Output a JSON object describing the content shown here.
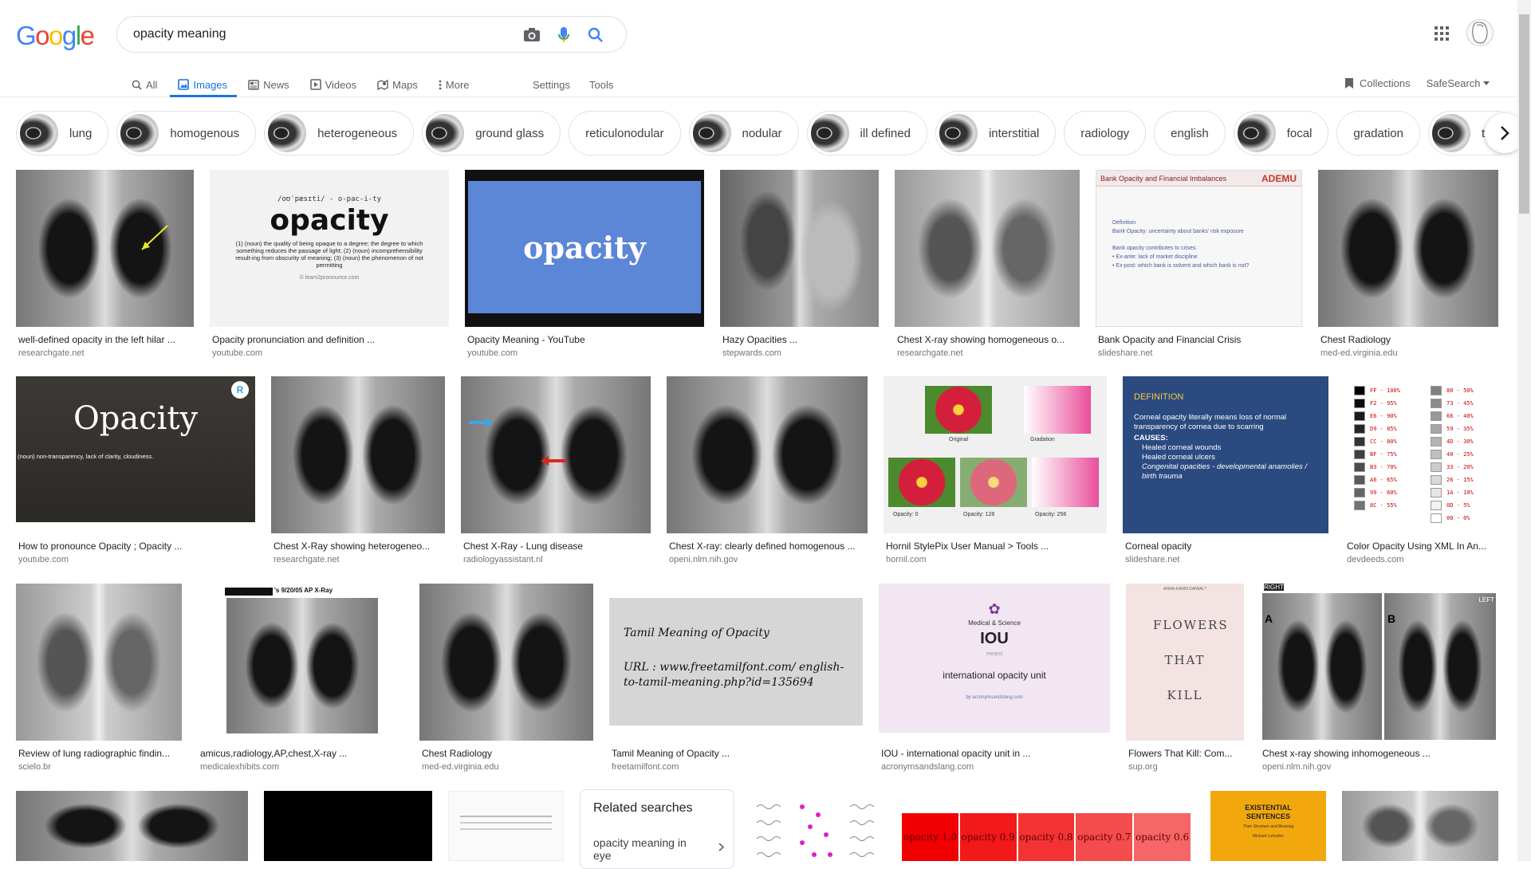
{
  "logo": [
    "G",
    "o",
    "o",
    "g",
    "l",
    "e"
  ],
  "search": {
    "value": "opacity meaning"
  },
  "tabs": [
    {
      "label": "All",
      "icon": "search-icon"
    },
    {
      "label": "Images",
      "icon": "image-icon",
      "active": true
    },
    {
      "label": "News",
      "icon": "news-icon"
    },
    {
      "label": "Videos",
      "icon": "play-icon"
    },
    {
      "label": "Maps",
      "icon": "map-pin-icon"
    },
    {
      "label": "More",
      "icon": "more-vertical-icon"
    }
  ],
  "tools": {
    "settings": "Settings",
    "tools": "Tools"
  },
  "right": {
    "collections": "Collections",
    "safesearch": "SafeSearch"
  },
  "chips": [
    {
      "label": "lung",
      "img": true
    },
    {
      "label": "homogenous",
      "img": true
    },
    {
      "label": "heterogeneous",
      "img": true
    },
    {
      "label": "ground glass",
      "img": true
    },
    {
      "label": "reticulonodular",
      "img": false
    },
    {
      "label": "nodular",
      "img": true
    },
    {
      "label": "ill defined",
      "img": true
    },
    {
      "label": "interstitial",
      "img": true
    },
    {
      "label": "radiology",
      "img": false
    },
    {
      "label": "english",
      "img": false
    },
    {
      "label": "focal",
      "img": true
    },
    {
      "label": "gradation",
      "img": false
    },
    {
      "label": "transparency",
      "img": true
    }
  ],
  "results": [
    {
      "caption": "well-defined opacity in the left hilar ...",
      "source": "researchgate.net"
    },
    {
      "caption": "Opacity pronunciation and definition ...",
      "source": "youtube.com"
    },
    {
      "caption": "Opacity Meaning - YouTube",
      "source": "youtube.com"
    },
    {
      "caption": "Hazy Opacities ...",
      "source": "stepwards.com"
    },
    {
      "caption": "Chest X-ray showing homogeneous o...",
      "source": "researchgate.net"
    },
    {
      "caption": "Bank Opacity and Financial Crisis",
      "source": "slideshare.net"
    },
    {
      "caption": "Chest Radiology",
      "source": "med-ed.virginia.edu"
    },
    {
      "caption": "How to pronounce Opacity ; Opacity ...",
      "source": "youtube.com"
    },
    {
      "caption": "Chest X-Ray showing heterogeneo...",
      "source": "researchgate.net"
    },
    {
      "caption": "Chest X-Ray - Lung disease",
      "source": "radiologyassistant.nl"
    },
    {
      "caption": "Chest X-ray: clearly defined homogenous ...",
      "source": "openi.nlm.nih.gov"
    },
    {
      "caption": "Hornil StylePix User Manual > Tools ...",
      "source": "hornil.com"
    },
    {
      "caption": "Corneal opacity",
      "source": "slideshare.net"
    },
    {
      "caption": "Color Opacity Using XML In An...",
      "source": "devdeeds.com"
    },
    {
      "caption": "Review of lung radiographic findin...",
      "source": "scielo.br"
    },
    {
      "caption": "amicus,radiology,AP,chest,X-ray ...",
      "source": "medicalexhibits.com"
    },
    {
      "caption": "Chest Radiology",
      "source": "med-ed.virginia.edu"
    },
    {
      "caption": "Tamil Meaning of Opacity ...",
      "source": "freetamilfont.com"
    },
    {
      "caption": "IOU - international opacity unit in ...",
      "source": "acronymsandslang.com"
    },
    {
      "caption": "Flowers That Kill: Com...",
      "source": "sup.org"
    },
    {
      "caption": "Chest x-ray showing inhomogeneous ...",
      "source": "openi.nlm.nih.gov"
    }
  ],
  "thumbs": {
    "r1_phonetic": "/oʊˈpæsɪti/ - o-pac-i-ty",
    "r1_word": "opacity",
    "r1_def": "(1) (noun) the quality of being opaque to a degree; the degree to which something reduces the passage of light; (2) (noun) incomprehensibility result-ing from obscurity of meaning; (3) (noun) the phenomenon of not permitting",
    "r1_copy": "© learn2pronounce.com",
    "r2_word": "opacity",
    "r5_title": "Bank Opacity and Financial Imbalances",
    "r5_brand": "ADEMU",
    "r5_l1": "Definition",
    "r5_l2": "Bank Opacity: uncertainty about banks' risk exposure",
    "r5_l3": "Bank opacity contributes to crises:",
    "r5_l4": "• Ex-ante: lack of market discipline",
    "r5_l5": "• Ex-post: which bank is solvent and which bank is not?",
    "r7_word": "Opacity",
    "r7_def": "(noun) non-transparency, lack of clarity, cloudiness.",
    "r11_orig": "Original",
    "r11_grad": "Gradation",
    "r11_o0": "Opacity: 0",
    "r11_o128": "Opacity: 128",
    "r11_o256": "Opacity: 256",
    "r12_head": "DEFINITION",
    "r12_l1": "Corneal opacity literally means loss of normal transparency of cornea due to scarring",
    "r12_l2": "CAUSES:",
    "r12_l3": "Healed corneal wounds",
    "r12_l4": "Healed corneal ulcers",
    "r12_l5": "Congenital opacities - developmental anamolies / birth trauma",
    "r13_left": [
      "FF - 100%",
      "F2 - 95%",
      "E6 - 90%",
      "D9 - 85%",
      "CC - 80%",
      "BF - 75%",
      "B3 - 70%",
      "A6 - 65%",
      "99 - 60%",
      "8C - 55%"
    ],
    "r13_right": [
      "80 - 50%",
      "73 - 45%",
      "66 - 40%",
      "59 - 35%",
      "4D - 30%",
      "40 - 25%",
      "33 - 20%",
      "26 - 15%",
      "1A - 10%",
      "0D - 5%",
      "00 - 0%"
    ],
    "r15_title": "'s 9/20/05 AP X-Ray",
    "r17_title": "Tamil Meaning of Opacity",
    "r17_url": "URL : www.freetamilfont.com/ english-to-tamil-meaning.php?id=135694",
    "r18_cat": "Medical & Science",
    "r18_abbr": "IOU",
    "r18_means": "means",
    "r18_full": "international opacity unit",
    "r18_by": "by acronymsandslang.com",
    "r19_title": "FLOWERS THAT KILL",
    "r19_author": "ANNA-KARIN DAIWAL?",
    "r20_a": "A",
    "r20_b": "B",
    "r20_right": "RIGHT",
    "r20_left": "LEFT",
    "b_opacities": [
      "opacity 1.0",
      "opacity 0.9",
      "opacity 0.8",
      "opacity 0.7",
      "opacity 0.6"
    ],
    "b_book": "EXISTENTIAL SENTENCES",
    "b_book_sub": "Their Structure and Meaning",
    "b_book_author": "Michael Lumsden"
  },
  "related": {
    "title": "Related searches",
    "item": "opacity meaning in eye"
  },
  "colors": {
    "accent": "#1a73e8",
    "text": "#202124",
    "muted": "#70757a",
    "border": "#dfe1e5"
  }
}
